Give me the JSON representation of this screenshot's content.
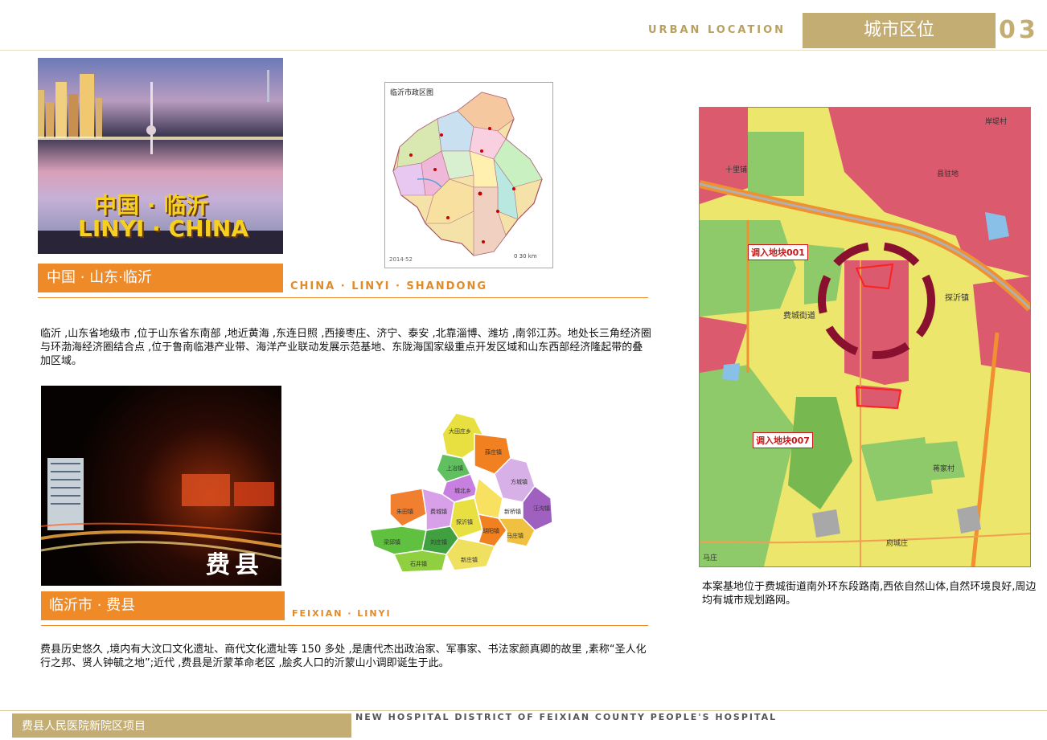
{
  "header": {
    "english_title": "URBAN LOCATION",
    "chinese_title": "城市区位",
    "page_number": "03"
  },
  "section1": {
    "photo_text_cn": "中国 · 临沂",
    "photo_text_en": "LINYI · CHINA",
    "caption": "中国 · 山东·临沂",
    "caption_en": "CHINA · LINYI · SHANDONG",
    "map_title": "临沂市政区图",
    "map_scale": "0 30 km",
    "map_year": "2014·52",
    "paragraph": "临沂 ,山东省地级市 ,位于山东省东南部 ,地近黄海 ,东连日照 ,西接枣庄、济宁、泰安 ,北靠淄博、潍坊 ,南邻江苏。地处长三角经济圈与环渤海经济圈结合点 ,位于鲁南临港产业带、海洋产业联动发展示范基地、东陇海国家级重点开发区域和山东西部经济隆起带的叠加区域。"
  },
  "section2": {
    "photo_text": "费县",
    "caption": "临沂市 · 费县",
    "caption_en": "FEIXIAN · LINYI",
    "county_labels": [
      "大田庄乡",
      "薛庄镇",
      "上冶镇",
      "城北乡",
      "新桥镇",
      "方城镇",
      "汪沟镇",
      "朱田镇",
      "费城镇",
      "探沂镇",
      "胡阳镇",
      "梁邱镇",
      "马庄镇",
      "刘庄镇",
      "石井镇",
      "新庄镇"
    ],
    "paragraph": "费县历史悠久 ,境内有大汶口文化遗址、商代文化遗址等 150 多处 ,是唐代杰出政治家、军事家、书法家颜真卿的故里 ,素称“圣人化行之邦、贤人钟毓之地”;近代 ,费县是沂蒙革命老区 ,脍炙人口的沂蒙山小调即诞生于此。"
  },
  "site_map": {
    "label_a": "调入地块001",
    "label_b": "调入地块007",
    "place_labels": [
      "十里铺",
      "费城街道",
      "探沂镇",
      "县驻地",
      "岸堤村",
      "蒋家村",
      "府城庄",
      "马庄"
    ],
    "paragraph": "本案基地位于费城街道南外环东段路南,西依自然山体,自然环境良好,周边均有城市规划路网。"
  },
  "footer": {
    "project_name": "费县人民医院新院区项目",
    "project_name_en": "NEW HOSPITAL DISTRICT OF FEIXIAN COUNTY PEOPLE'S HOSPITAL"
  },
  "colors": {
    "gold": "#c3ad72",
    "orange": "#ee8a28",
    "site_red": "#8a1030"
  }
}
